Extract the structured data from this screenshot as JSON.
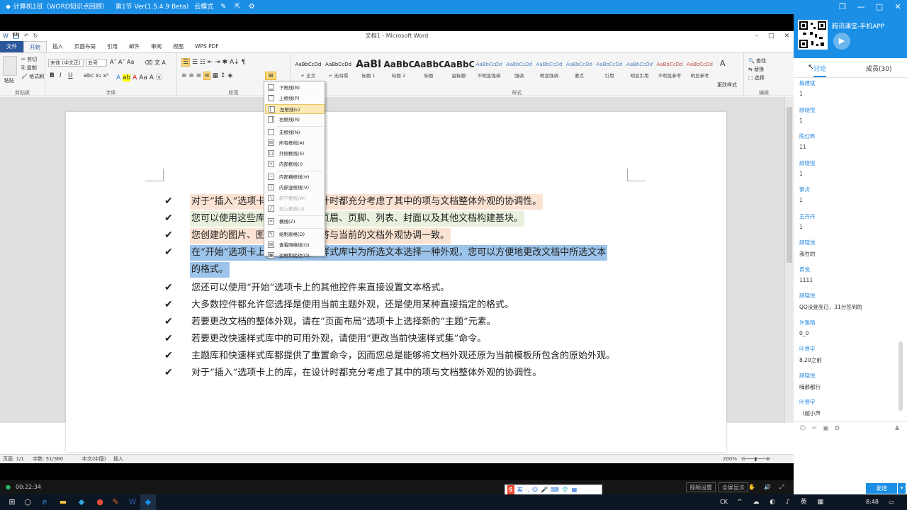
{
  "app": {
    "title_bar": "计算机1班（WORD知识点回顾） · 第1节 Ver(1.5.4.9 Beta) · 云模式",
    "title_parts": [
      "计算机1班（WORD知识点回顾）",
      "第1节 Ver(1.5.4.9 Beta)",
      "云模式"
    ],
    "accent": "#1b8fe6"
  },
  "word": {
    "doc_title": "文档1 - Microsoft Word",
    "tabs": [
      "文件",
      "开始",
      "插入",
      "页面布局",
      "引用",
      "邮件",
      "审阅",
      "视图",
      "WPS PDF"
    ],
    "active_tab": "开始",
    "clipboard": {
      "paste": "粘贴",
      "cut": "剪切",
      "copy": "复制",
      "format_painter": "格式刷",
      "label": "剪贴板"
    },
    "font": {
      "name": "宋体 (中文正)",
      "size": "五号",
      "label": "字体"
    },
    "paragraph_label": "段落",
    "styles_label": "样式",
    "editing": {
      "find": "查找",
      "replace": "替换",
      "select": "选择",
      "label": "编辑"
    },
    "change_styles": "更改样式",
    "styles": [
      {
        "preview": "AaBbCcDd",
        "name": "↵ 正文"
      },
      {
        "preview": "AaBbCcDd",
        "name": "↵ 无间隔"
      },
      {
        "preview": "AaBl",
        "name": "标题 1"
      },
      {
        "preview": "AaBbC",
        "name": "标题 2"
      },
      {
        "preview": "AaBbC",
        "name": "标题"
      },
      {
        "preview": "AaBbC",
        "name": "副标题"
      },
      {
        "preview": "AaBbCcDd",
        "name": "不明显强调"
      },
      {
        "preview": "AaBbCcDd",
        "name": "强调"
      },
      {
        "preview": "AaBbCcDd",
        "name": "明显强调"
      },
      {
        "preview": "AaBbCcDd",
        "name": "要点"
      },
      {
        "preview": "AaBbCcDd",
        "name": "引用"
      },
      {
        "preview": "AaBbCcDd",
        "name": "明显引用"
      },
      {
        "preview": "AaBbCcDd",
        "name": "不明显参考"
      },
      {
        "preview": "AaBbCcDd",
        "name": "明显参考"
      }
    ],
    "border_menu": [
      {
        "label": "下框线(B)",
        "icon": "▁",
        "state": "normal"
      },
      {
        "label": "上框线(P)",
        "icon": "▔",
        "state": "normal"
      },
      {
        "label": "左框线(L)",
        "icon": "▏",
        "state": "hot"
      },
      {
        "label": "右框线(R)",
        "icon": "▕",
        "state": "normal"
      },
      {
        "sep": true
      },
      {
        "label": "无框线(N)",
        "icon": " ",
        "state": "normal"
      },
      {
        "label": "所有框线(A)",
        "icon": "⊞",
        "state": "normal"
      },
      {
        "label": "外侧框线(S)",
        "icon": "□",
        "state": "normal"
      },
      {
        "label": "内部框线(I)",
        "icon": "+",
        "state": "normal"
      },
      {
        "sep": true
      },
      {
        "label": "内部横框线(H)",
        "icon": "─",
        "state": "normal"
      },
      {
        "label": "内部竖框线(V)",
        "icon": "│",
        "state": "normal"
      },
      {
        "label": "斜下框线(W)",
        "icon": "╲",
        "state": "disabled"
      },
      {
        "label": "斜上框线(U)",
        "icon": "╱",
        "state": "disabled"
      },
      {
        "sep": true
      },
      {
        "label": "横线(Z)",
        "icon": "═",
        "state": "normal"
      },
      {
        "sep": true
      },
      {
        "label": "绘制表格(D)",
        "icon": "✎",
        "state": "normal"
      },
      {
        "label": "查看网格线(G)",
        "icon": "⊞",
        "state": "normal"
      },
      {
        "label": "边框和底纹(O)...",
        "icon": "▦",
        "state": "normal"
      }
    ],
    "document_lines": [
      {
        "text": "对于“插入”选项卡上的库，在设计时都充分考虑了其中的项与文档整体外观的协调性。",
        "hl": "o"
      },
      {
        "text": "您可以使用这些库来插入表格、页眉、页脚、列表、封面以及其他文档构建基块。",
        "hl": "g"
      },
      {
        "text": "您创建的图片、图表或关系图也将与当前的文档外观协调一致。",
        "hl": "o"
      },
      {
        "text": "在“开始”选项卡上，通过从快速样式库中为所选文本选择一种外观，您可以方便地更改文档中所选文本",
        "hl": "b"
      },
      {
        "text": "的格式。",
        "hl": "b",
        "continuation": true
      },
      {
        "text": "您还可以使用“开始”选项卡上的其他控件来直接设置文本格式。",
        "hl": ""
      },
      {
        "text": "大多数控件都允许您选择是使用当前主题外观，还是使用某种直接指定的格式。",
        "hl": ""
      },
      {
        "text": "若要更改文档的整体外观，请在“页面布局”选项卡上选择新的“主题”元素。",
        "hl": ""
      },
      {
        "text": "若要更改快速样式库中的可用外观，请使用“更改当前快速样式集”命令。",
        "hl": ""
      },
      {
        "text": "主题库和快速样式库都提供了重置命令，因而您总是能够将文档外观还原为当前模板所包含的原始外观。",
        "hl": ""
      },
      {
        "text": "对于“插入”选项卡上的库，在设计时都充分考虑了其中的项与文档整体外观的协调性。",
        "hl": ""
      }
    ],
    "status": {
      "page": "页面: 1/1",
      "words": "字数: 51/380",
      "lang": "中文(中国)",
      "mode": "插入",
      "zoom": "200%"
    }
  },
  "chat": {
    "app_name": "腾讯课堂-手机APP",
    "tab_discuss": "讨论",
    "tab_members": "成员(30)",
    "messages": [
      {
        "name": "梅建斌",
        "text": "1"
      },
      {
        "name": "顾晓悦",
        "text": "1"
      },
      {
        "name": "陈红晔",
        "text": "11"
      },
      {
        "name": "顾晓悦",
        "text": "1"
      },
      {
        "name": "黎贞",
        "text": "1"
      },
      {
        "name": "王丹丹",
        "text": "1"
      },
      {
        "name": "顾晓悦",
        "text": "我在的"
      },
      {
        "name": "黄悦",
        "text": "1111"
      },
      {
        "name": "顾晓悦",
        "text": "QQ没登亮已，31分签到的"
      },
      {
        "name": "许雅晴",
        "text": "0_0"
      },
      {
        "name": "叶费宇",
        "text": "8.20之前"
      },
      {
        "name": "顾晓悦",
        "text": "嗨那都行"
      },
      {
        "name": "叶费宇",
        "text": "（超小声"
      }
    ],
    "send_label": "发送"
  },
  "player": {
    "time": "00:22:34",
    "btn_video": "视频设置",
    "btn_fullscreen": "全屏显示"
  },
  "taskbar": {
    "clock": "8:48",
    "tray_text": "CK"
  },
  "ime": {
    "label": "英"
  }
}
